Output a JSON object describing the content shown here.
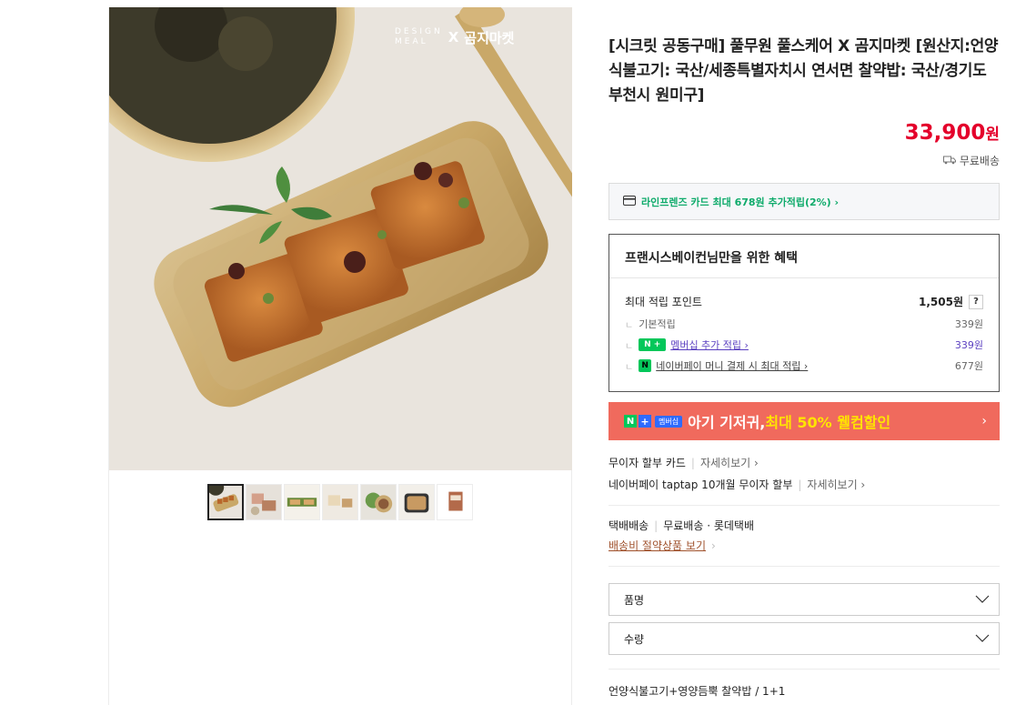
{
  "image": {
    "brand_design_line1": "DESIGN",
    "brand_design_line2": "MEAL",
    "brand_x": "X",
    "brand_partner": "곰지마켓"
  },
  "thumbnails": [
    {
      "name": "thumb-1",
      "active": true
    },
    {
      "name": "thumb-2",
      "active": false
    },
    {
      "name": "thumb-3",
      "active": false
    },
    {
      "name": "thumb-4",
      "active": false
    },
    {
      "name": "thumb-5",
      "active": false
    },
    {
      "name": "thumb-6",
      "active": false
    },
    {
      "name": "thumb-7",
      "active": false
    }
  ],
  "product": {
    "title": "[시크릿 공동구매] 풀무원 풀스케어 X 곰지마켓 [원산지:언양식불고기: 국산/세종특별자치시 연서면 찰약밥: 국산/경기도 부천시 원미구]",
    "price_number": "33,900",
    "price_unit": "원",
    "shipping_tag": "무료배송"
  },
  "card_promo": {
    "text": "라인프렌즈 카드 최대 678원 추가적립(2%) ›"
  },
  "benefit": {
    "title": "프랜시스베이컨님만을 위한 혜택",
    "max_points_label": "최대 적립 포인트",
    "max_points_value": "1,505원",
    "help": "?",
    "rows": [
      {
        "label": "기본적립",
        "value": "339원"
      },
      {
        "label": "멤버십 추가 적립 ›",
        "value": "339원"
      },
      {
        "label": "네이버페이 머니 결제 시 최대 적립 ›",
        "value": "677원"
      }
    ],
    "npay_badge_1": "N +",
    "npay_badge_2": "N"
  },
  "banner": {
    "badge_n": "N",
    "badge_plus": "+",
    "badge_member": "멤버십",
    "text_prefix": "아기 기저귀, ",
    "text_highlight": "최대 50% 웰컴할인",
    "chevron": "›"
  },
  "installment": [
    {
      "label": "무이자 할부 카드",
      "more": "자세히보기 ›"
    },
    {
      "label": "네이버페이 taptap 10개월 무이자 할부",
      "more": "자세히보기 ›"
    }
  ],
  "delivery": {
    "type": "택배배송",
    "fee": "무료배송 · 롯데택배",
    "saving_link": "배송비 절약상품 보기",
    "saving_chevron": "›"
  },
  "options": [
    {
      "label": "품명"
    },
    {
      "label": "수량"
    }
  ],
  "selected_option": "언양식불고기+영양듬뿍 찰약밥 / 1+1",
  "colors": {
    "price": "#e4002b",
    "naver_green": "#03c75a",
    "banner": "#f06a5d",
    "banner_highlight": "#ffe400"
  }
}
